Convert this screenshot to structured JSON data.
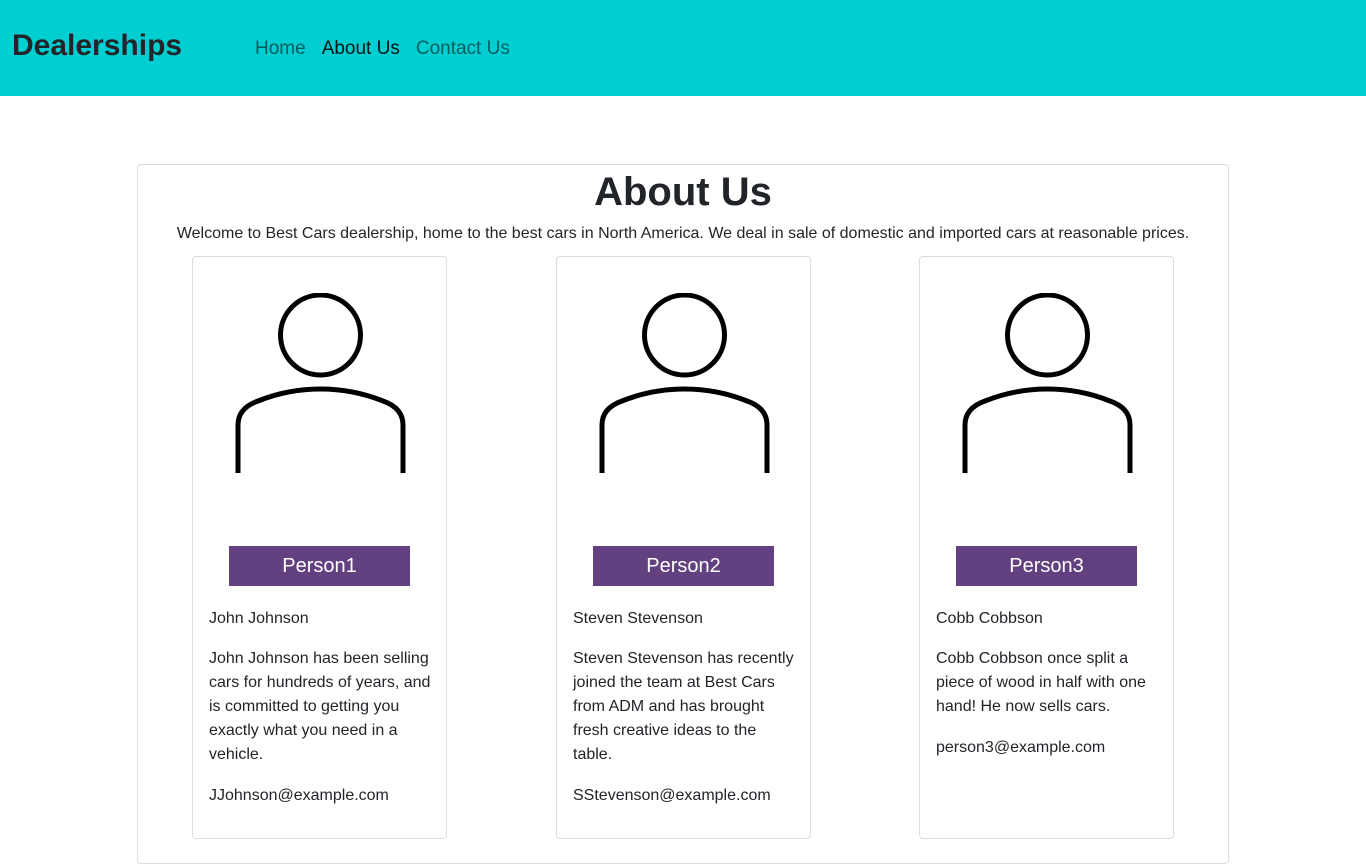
{
  "nav": {
    "brand": "Dealerships",
    "links": [
      {
        "label": "Home",
        "active": false
      },
      {
        "label": "About Us",
        "active": true
      },
      {
        "label": "Contact Us",
        "active": false
      }
    ]
  },
  "about": {
    "title": "About Us",
    "intro": "Welcome to Best Cars dealership, home to the best cars in North America. We deal in sale of domestic and imported cars at reasonable prices."
  },
  "people": [
    {
      "badge": "Person1",
      "name": "John Johnson",
      "description": "John Johnson has been selling cars for hundreds of years, and is committed to getting you exactly what you need in a vehicle.",
      "email": "JJohnson@example.com"
    },
    {
      "badge": "Person2",
      "name": "Steven Stevenson",
      "description": "Steven Stevenson has recently joined the team at Best Cars from ADM and has brought fresh creative ideas to the table.",
      "email": "SStevenson@example.com"
    },
    {
      "badge": "Person3",
      "name": "Cobb Cobbson",
      "description": "Cobb Cobbson once split a piece of wood in half with one hand! He now sells cars.",
      "email": "person3@example.com"
    }
  ],
  "colors": {
    "navbar": "#00ced1",
    "badge": "#634080"
  },
  "icons": {
    "avatar": "person-outline-icon"
  }
}
